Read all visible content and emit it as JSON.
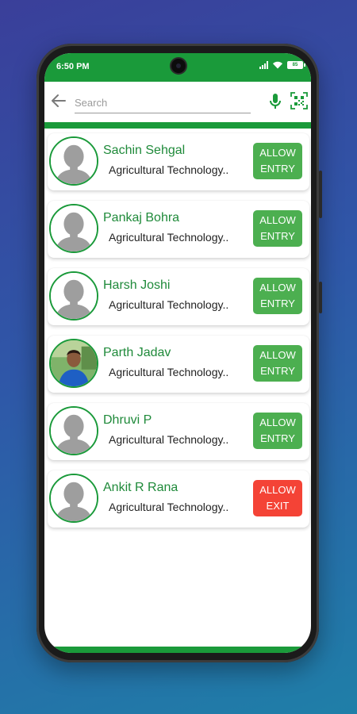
{
  "status_bar": {
    "time": "6:50 PM",
    "battery_level": "85"
  },
  "search": {
    "placeholder": "Search"
  },
  "colors": {
    "brand_green": "#1a9a3a",
    "allow_entry": "#4caf50",
    "allow_exit": "#f44336"
  },
  "visitors": [
    {
      "name": "Sachin Sehgal",
      "organization": "Agricultural Technology..",
      "action_line1": "ALLOW",
      "action_line2": "ENTRY",
      "action_type": "entry",
      "has_photo": false
    },
    {
      "name": "Pankaj Bohra",
      "organization": "Agricultural Technology..",
      "action_line1": "ALLOW",
      "action_line2": "ENTRY",
      "action_type": "entry",
      "has_photo": false
    },
    {
      "name": "Harsh Joshi",
      "organization": "Agricultural Technology..",
      "action_line1": "ALLOW",
      "action_line2": "ENTRY",
      "action_type": "entry",
      "has_photo": false
    },
    {
      "name": "Parth Jadav",
      "organization": "Agricultural Technology..",
      "action_line1": "ALLOW",
      "action_line2": "ENTRY",
      "action_type": "entry",
      "has_photo": true
    },
    {
      "name": "Dhruvi P",
      "organization": "Agricultural Technology..",
      "action_line1": "ALLOW",
      "action_line2": "ENTRY",
      "action_type": "entry",
      "has_photo": false
    },
    {
      "name": "Ankit R Rana",
      "organization": "Agricultural Technology..",
      "action_line1": "ALLOW",
      "action_line2": "EXIT",
      "action_type": "exit",
      "has_photo": false
    }
  ]
}
